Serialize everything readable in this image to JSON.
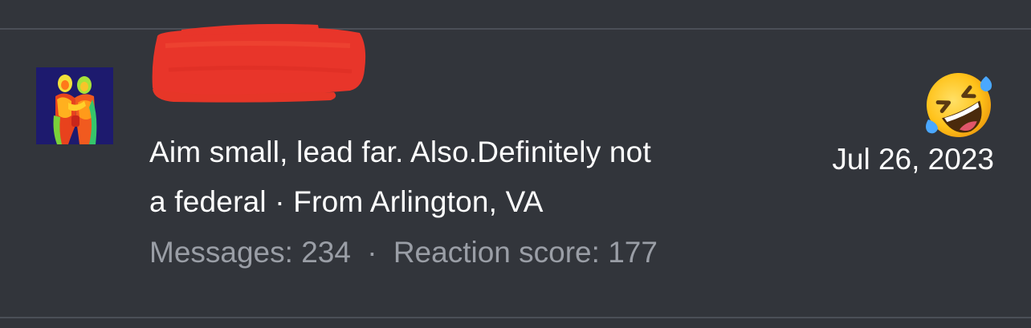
{
  "post": {
    "author_name": "",
    "bio_line1": "Aim small, lead far. Also.Definitely not",
    "bio_line2": "a federal · From Arlington, VA",
    "messages_label": "Messages:",
    "messages_count": "234",
    "separator": "·",
    "reaction_score_label": "Reaction score:",
    "reaction_score_value": "177",
    "date": "Jul 26, 2023",
    "reaction_icon": "rolling-on-the-floor-laughing-emoji"
  },
  "colors": {
    "background": "#32353b",
    "divider": "#4b4f57",
    "primary_text": "#ffffff",
    "secondary_text": "#9a9ea6",
    "redaction": "#e8352a"
  }
}
